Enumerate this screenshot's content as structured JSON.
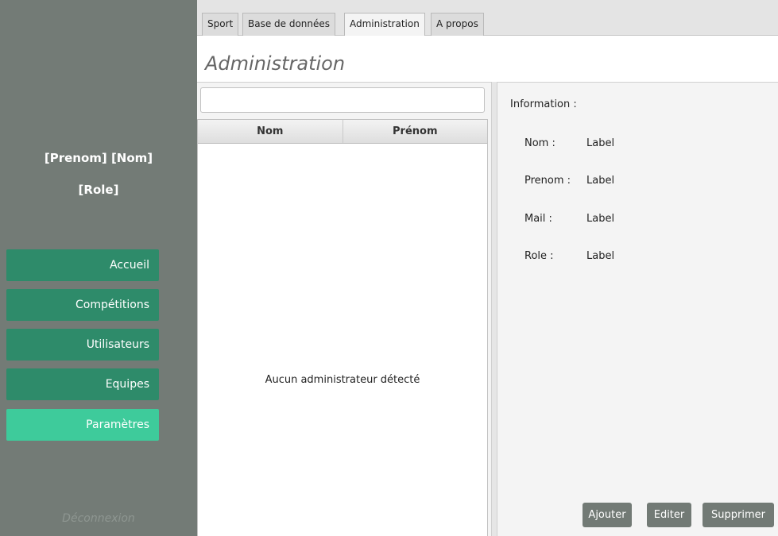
{
  "sidebar": {
    "user_name": "[Prenom] [Nom]",
    "user_role": "[Role]",
    "nav": [
      "Accueil",
      "Compétitions",
      "Utilisateurs",
      "Equipes",
      "Paramètres"
    ],
    "active_item": "Paramètres",
    "logout_label": "Déconnexion"
  },
  "tabs": [
    "Sport",
    "Base de données",
    "Administration",
    "A propos"
  ],
  "selected_tab": "Administration",
  "page_title": "Administration",
  "search": {
    "value": "",
    "placeholder": ""
  },
  "table": {
    "columns": [
      "Nom",
      "Prénom"
    ],
    "rows": [],
    "empty_message": "Aucun administrateur détecté"
  },
  "details": {
    "title": "Information :",
    "fields": [
      {
        "label": "Nom :",
        "value": "Label"
      },
      {
        "label": "Prenom :",
        "value": "Label"
      },
      {
        "label": "Mail :",
        "value": "Label"
      },
      {
        "label": "Role :",
        "value": "Label"
      }
    ]
  },
  "actions": [
    "Ajouter",
    "Editer",
    "Supprimer"
  ],
  "colors": {
    "sidebar_bg": "#737b76",
    "nav_button": "#2e8b6a",
    "nav_button_active": "#3ecb9b",
    "action_button": "#727a75"
  }
}
